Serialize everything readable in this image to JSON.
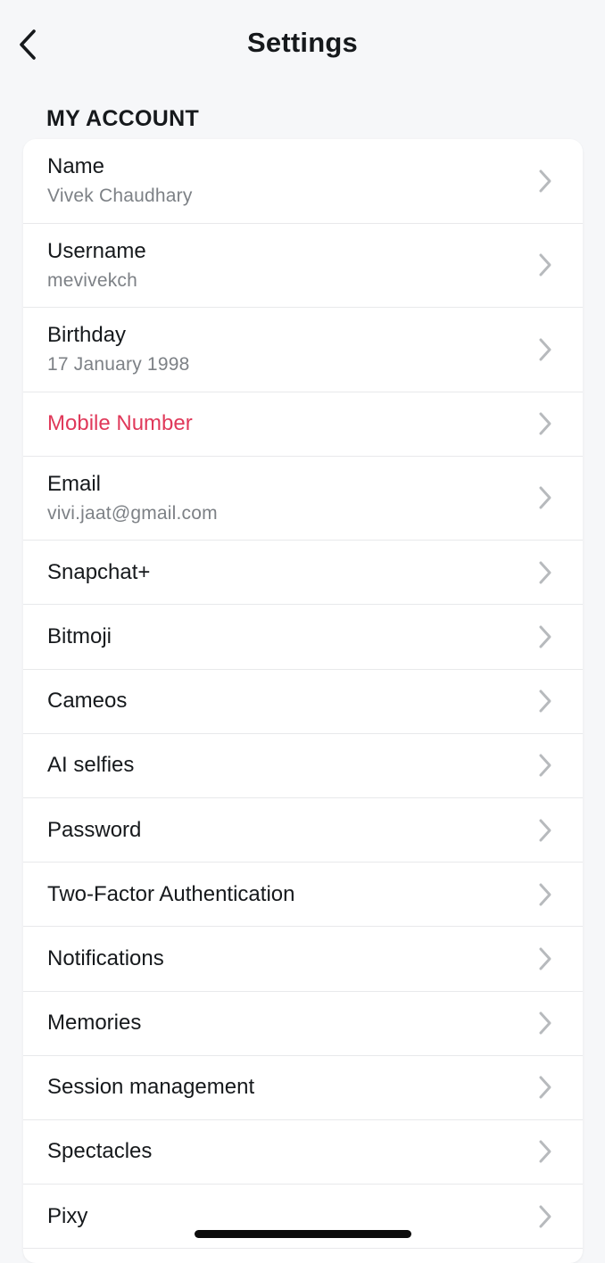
{
  "header": {
    "title": "Settings",
    "back_icon": "chevron-left-icon"
  },
  "section": {
    "title": "MY ACCOUNT"
  },
  "rows": [
    {
      "label": "Name",
      "value": "Vivek Chaudhary"
    },
    {
      "label": "Username",
      "value": "mevivekch"
    },
    {
      "label": "Birthday",
      "value": "17 January 1998"
    },
    {
      "label": "Mobile Number",
      "color": "#e0395a"
    },
    {
      "label": "Email",
      "value": "vivi.jaat@gmail.com"
    },
    {
      "label": "Snapchat+"
    },
    {
      "label": "Bitmoji"
    },
    {
      "label": "Cameos"
    },
    {
      "label": "AI selfies"
    },
    {
      "label": "Password"
    },
    {
      "label": "Two-Factor Authentication"
    },
    {
      "label": "Notifications"
    },
    {
      "label": "Memories"
    },
    {
      "label": "Session management"
    },
    {
      "label": "Spectacles"
    },
    {
      "label": "Pixy"
    }
  ],
  "colors": {
    "background": "#f6f7f9",
    "card": "#ffffff",
    "text_primary": "#16191c",
    "text_secondary": "#7d8186",
    "alert": "#e0395a",
    "chevron": "#b7babd"
  }
}
